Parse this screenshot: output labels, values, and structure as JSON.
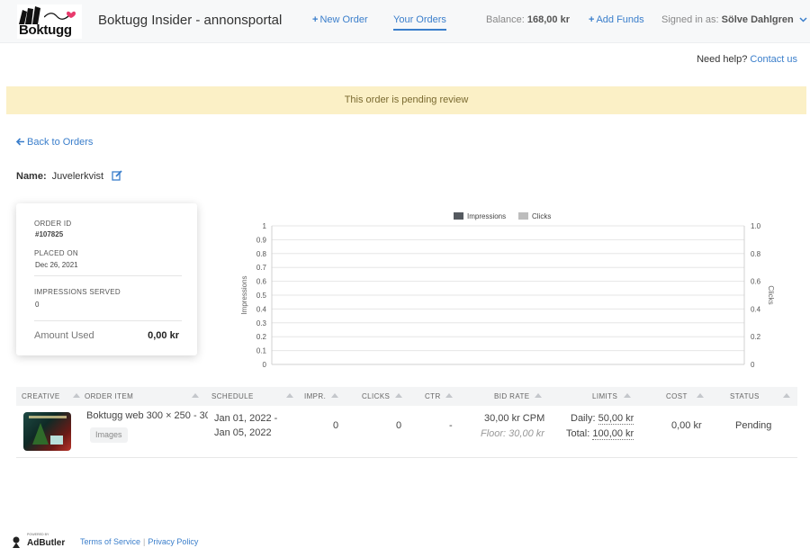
{
  "header": {
    "logo_text": "Boktugg",
    "site_title": "Boktugg Insider - annonsportal",
    "nav": {
      "new_order": "New Order",
      "your_orders": "Your Orders",
      "add_funds": "Add Funds"
    },
    "balance_label": "Balance:",
    "balance_value": "168,00 kr",
    "signed_in_label": "Signed in as:",
    "signed_in_user": "Sölve Dahlgren"
  },
  "help": {
    "text": "Need help?",
    "link": "Contact us"
  },
  "alert": {
    "text": "This order is pending review"
  },
  "back_link": "Back to Orders",
  "order": {
    "name_label": "Name:",
    "name_value": "Juvelerkvist",
    "card": {
      "order_id_label": "ORDER ID",
      "order_id_value": "#107825",
      "placed_on_label": "PLACED ON",
      "placed_on_value": "Dec 26, 2021",
      "impressions_label": "IMPRESSIONS SERVED",
      "impressions_value": "0",
      "amount_label": "Amount Used",
      "amount_value": "0,00 kr"
    }
  },
  "chart_data": {
    "type": "line",
    "legend": [
      "Impressions",
      "Clicks"
    ],
    "legend_position": "top-center",
    "series": [
      {
        "name": "Impressions",
        "color": "#555a60",
        "values": []
      },
      {
        "name": "Clicks",
        "color": "#bdbdbd",
        "values": []
      }
    ],
    "ylabel": "Impressions",
    "y2label": "Clicks",
    "ylim": [
      0,
      1
    ],
    "y2lim": [
      0,
      1.0
    ],
    "y_ticks": [
      "0",
      "0.1",
      "0.2",
      "0.3",
      "0.4",
      "0.5",
      "0.6",
      "0.7",
      "0.8",
      "0.9",
      "1"
    ],
    "y2_ticks": [
      "0",
      "0.2",
      "0.4",
      "0.6",
      "0.8",
      "1.0"
    ],
    "grid": true
  },
  "table": {
    "headers": [
      "CREATIVE",
      "ORDER ITEM",
      "SCHEDULE",
      "IMPR.",
      "CLICKS",
      "CTR",
      "BID RATE",
      "LIMITS",
      "COST",
      "STATUS"
    ],
    "rows": [
      {
        "item_name": "Boktugg web 300 × 250 - 30",
        "item_type": "Images",
        "schedule_start": "Jan 01, 2022 -",
        "schedule_end": "Jan 05, 2022",
        "impressions": "0",
        "clicks": "0",
        "ctr": "-",
        "bid_rate": "30,00 kr CPM",
        "floor": "Floor: 30,00 kr",
        "daily_label": "Daily:",
        "daily_value": "50,00 kr",
        "total_label": "Total:",
        "total_value": "100,00 kr",
        "cost": "0,00 kr",
        "status": "Pending"
      }
    ]
  },
  "footer": {
    "powered_by": "POWERED BY",
    "brand": "AdButler",
    "terms": "Terms of Service",
    "privacy": "Privacy Policy"
  }
}
